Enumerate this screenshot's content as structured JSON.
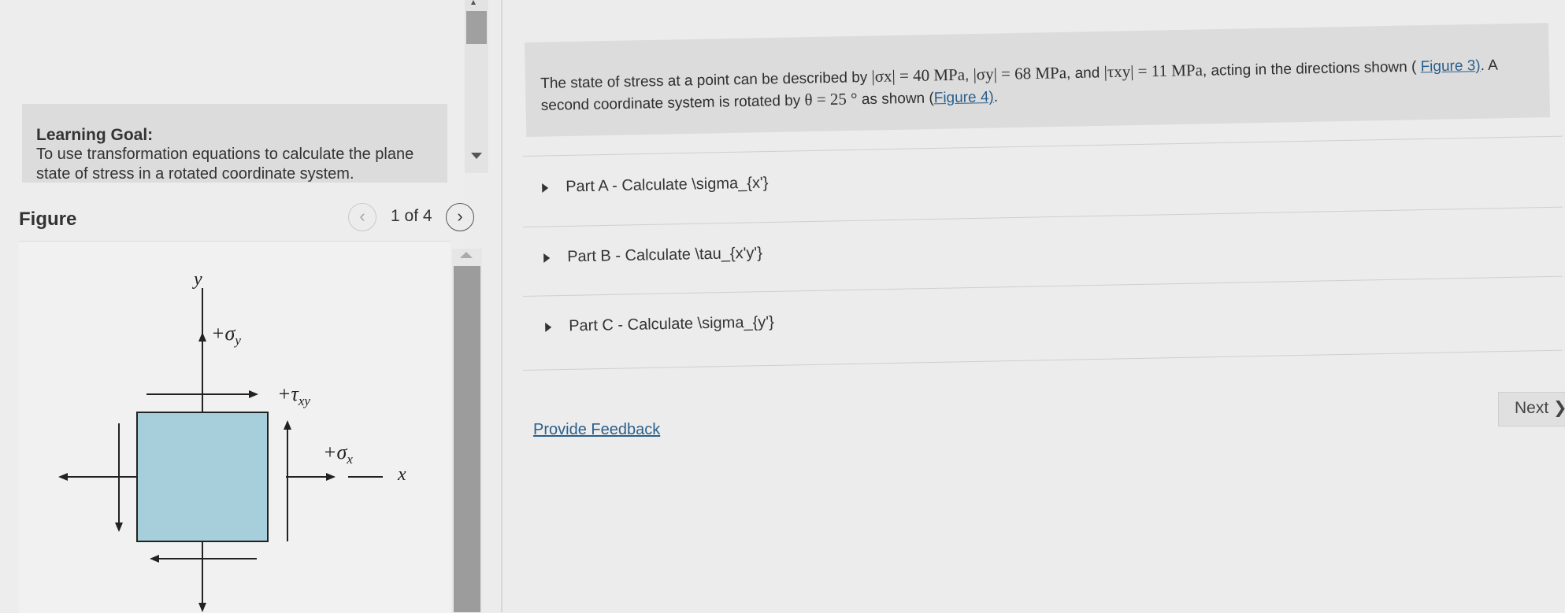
{
  "learning_goal": {
    "title": "Learning Goal:",
    "text": "To use transformation equations to calculate the plane state of stress in a rotated coordinate system."
  },
  "figure": {
    "title": "Figure",
    "page_indicator": "1 of 4",
    "prev_icon": "chevron-left-icon",
    "next_icon": "chevron-right-icon",
    "labels": {
      "y_axis": "y",
      "x_axis": "x",
      "sigma_y": "+σ",
      "sigma_y_sub": "y",
      "tau_xy": "+τ",
      "tau_xy_sub": "xy",
      "sigma_x": "+σ",
      "sigma_x_sub": "x"
    },
    "element_color": "#a7cedb"
  },
  "problem": {
    "intro": "The state of stress at a point can be described by",
    "sx_expr": "|σx| = 40 MPa",
    "sep1": ",",
    "sy_expr": "|σy| = 68 MPa",
    "sep2": ", and",
    "txy_expr": "|τxy| = 11 MPa",
    "mid": ", acting in the directions shown (",
    "fig3_link": "Figure 3)",
    "mid2": ". A second coordinate system is rotated by",
    "theta_expr": "θ = 25 °",
    "mid3": "as shown (",
    "fig4_link": "Figure 4)",
    "end": "."
  },
  "parts": [
    {
      "label": "Part A - Calculate \\sigma_{x'}"
    },
    {
      "label": "Part B - Calculate \\tau_{x'y'}"
    },
    {
      "label": "Part C - Calculate \\sigma_{y'}"
    }
  ],
  "feedback_link": "Provide Feedback",
  "next_button": "Next ❯",
  "colors": {
    "link": "#2b5f8a",
    "panel": "#dcdcdc"
  }
}
